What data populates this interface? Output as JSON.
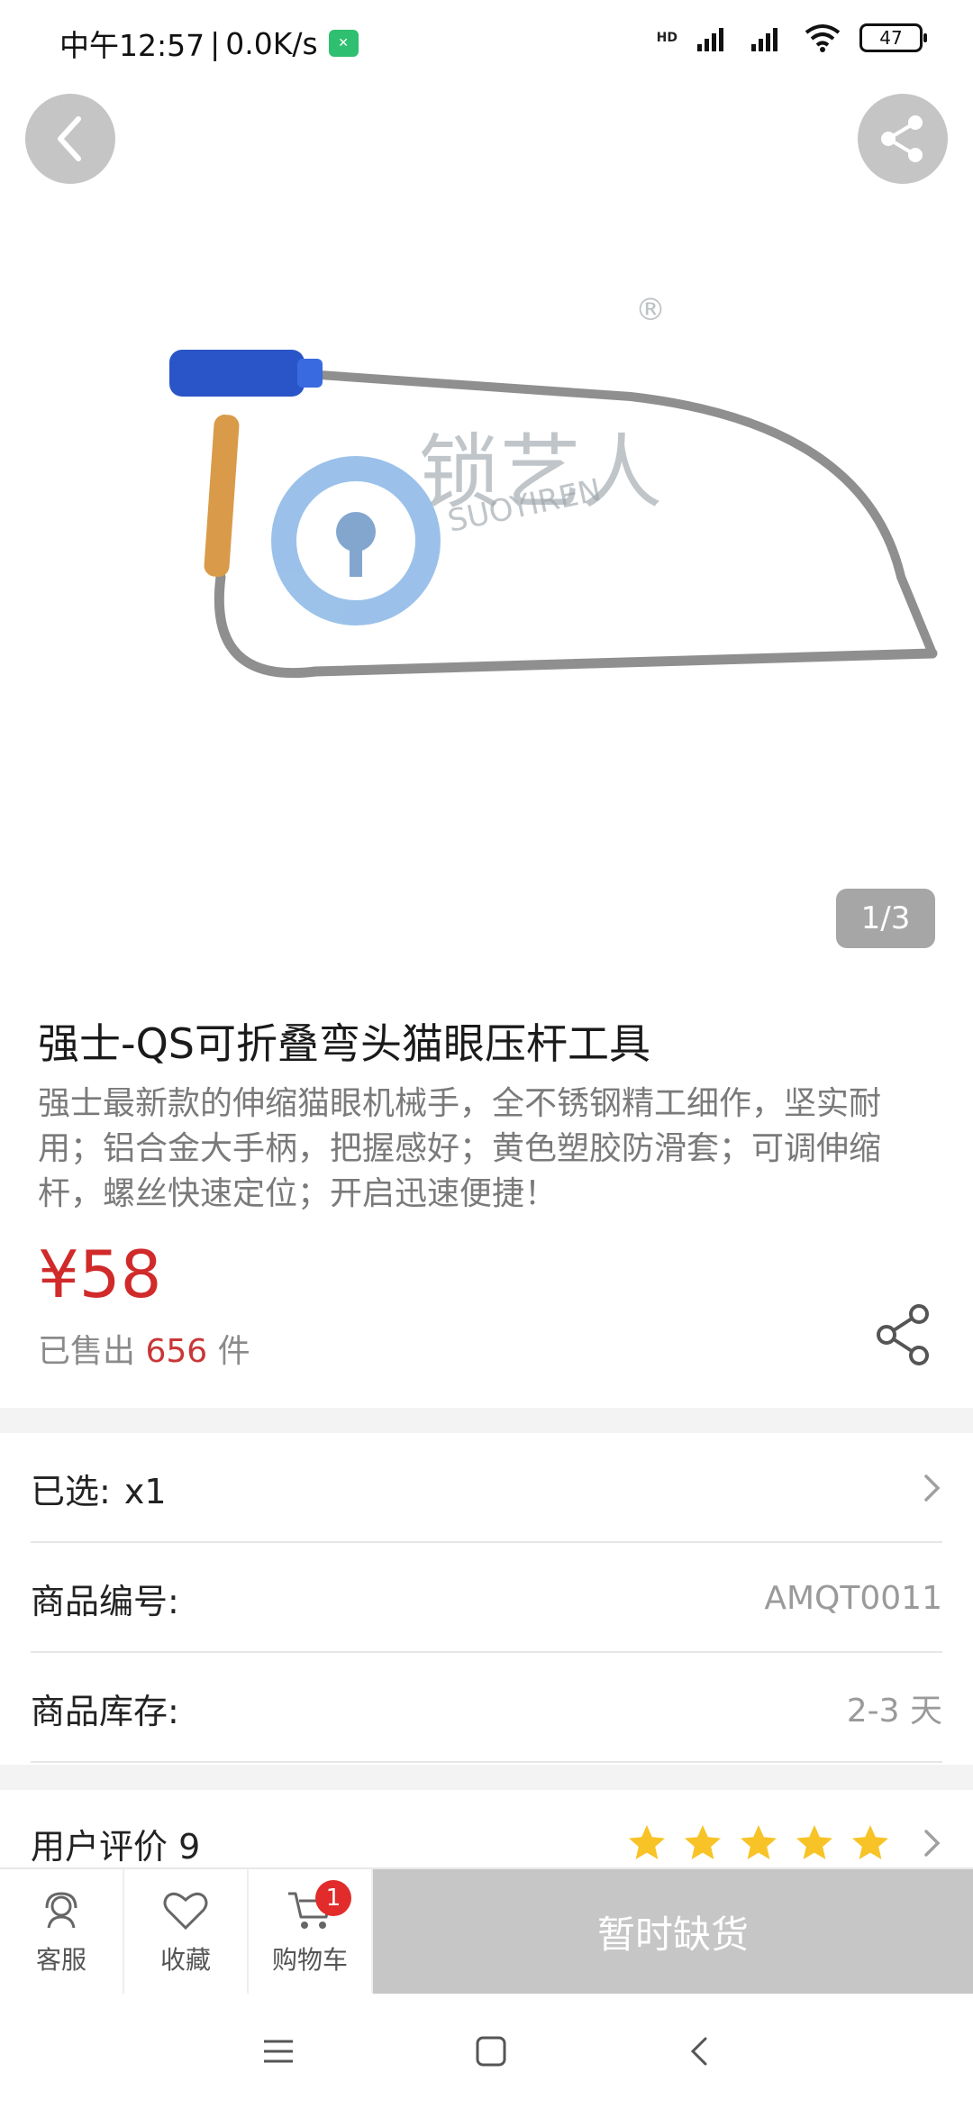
{
  "status_bar": {
    "time": "中午12:57",
    "speed": "0.0K/s",
    "network_label": "HD",
    "battery": "47"
  },
  "gallery": {
    "page_indicator": "1/3",
    "watermark_brand": "锁艺人",
    "watermark_sub": "SUOYIREN"
  },
  "product": {
    "title": "强士-QS可折叠弯头猫眼压杆工具",
    "description": "强士最新款的伸缩猫眼机械手，全不锈钢精工细作，坚实耐用；铝合金大手柄，把握感好；黄色塑胶防滑套；可调伸缩杆，螺丝快速定位；开启迅速便捷！",
    "price": "¥58",
    "sold_prefix": "已售出",
    "sold_count": "656",
    "sold_suffix": "件"
  },
  "details": {
    "selected_label": "已选:",
    "selected_value": "x1",
    "sku_label": "商品编号:",
    "sku_value": "AMQT0011",
    "stock_label": "商品库存:",
    "stock_value": "2-3 天",
    "reviews_label": "用户评价 9",
    "rating": 5
  },
  "actions": {
    "service": "客服",
    "favorite": "收藏",
    "cart": "购物车",
    "cart_count": "1",
    "buy": "暂时缺货"
  },
  "colors": {
    "price_red": "#d02a2a",
    "star_yellow": "#f7c326",
    "disabled_gray": "#c6c6c6"
  }
}
